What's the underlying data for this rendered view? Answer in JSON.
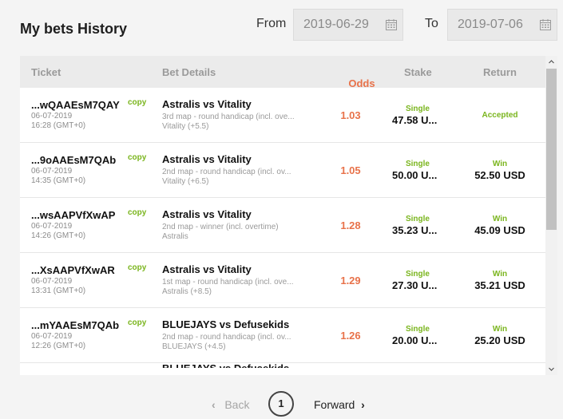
{
  "header": {
    "title": "My bets History",
    "from_label": "From",
    "from_value": "2019-06-29",
    "to_label": "To",
    "to_value": "2019-07-06"
  },
  "table": {
    "columns": [
      "Ticket",
      "Bet Details",
      "Odds",
      "Stake",
      "Return"
    ],
    "copy_label": "copy",
    "rows": [
      {
        "ticket": "...wQAAEsM7QAY",
        "date": "06-07-2019",
        "time": "16:28 (GMT+0)",
        "match": "Astralis vs Vitality",
        "market": "3rd map - round handicap (incl. ove...",
        "selection": "Vitality (+5.5)",
        "odds": "1.03",
        "stake_type": "Single",
        "stake": "47.58 U...",
        "return_status": "Accepted",
        "return_amount": ""
      },
      {
        "ticket": "...9oAAEsM7QAb",
        "date": "06-07-2019",
        "time": "14:35 (GMT+0)",
        "match": "Astralis vs Vitality",
        "market": "2nd map - round handicap (incl. ov...",
        "selection": "Vitality (+6.5)",
        "odds": "1.05",
        "stake_type": "Single",
        "stake": "50.00 U...",
        "return_status": "Win",
        "return_amount": "52.50 USD"
      },
      {
        "ticket": "...wsAAPVfXwAP",
        "date": "06-07-2019",
        "time": "14:26 (GMT+0)",
        "match": "Astralis vs Vitality",
        "market": "2nd map - winner (incl. overtime)",
        "selection": "Astralis",
        "odds": "1.28",
        "stake_type": "Single",
        "stake": "35.23 U...",
        "return_status": "Win",
        "return_amount": "45.09 USD"
      },
      {
        "ticket": "...XsAAPVfXwAR",
        "date": "06-07-2019",
        "time": "13:31 (GMT+0)",
        "match": "Astralis vs Vitality",
        "market": "1st map - round handicap (incl. ove...",
        "selection": "Astralis (+8.5)",
        "odds": "1.29",
        "stake_type": "Single",
        "stake": "27.30 U...",
        "return_status": "Win",
        "return_amount": "35.21 USD"
      },
      {
        "ticket": "...mYAAEsM7QAb",
        "date": "06-07-2019",
        "time": "12:26 (GMT+0)",
        "match": "BLUEJAYS vs Defusekids",
        "market": "2nd map - round handicap (incl. ov...",
        "selection": "BLUEJAYS (+4.5)",
        "odds": "1.26",
        "stake_type": "Single",
        "stake": "20.00 U...",
        "return_status": "Win",
        "return_amount": "25.20 USD"
      }
    ],
    "partial_row_match": "BLUEJAYS vs Defusekids"
  },
  "pager": {
    "back_label": "Back",
    "current_page": "1",
    "forward_label": "Forward"
  },
  "icons": [
    "calendar-icon",
    "chevron-left-icon",
    "chevron-right-icon",
    "scroll-up-arrow-icon",
    "scroll-down-arrow-icon"
  ],
  "colors": {
    "accent_green": "#7ab51d",
    "odds_orange": "#e8724a"
  }
}
